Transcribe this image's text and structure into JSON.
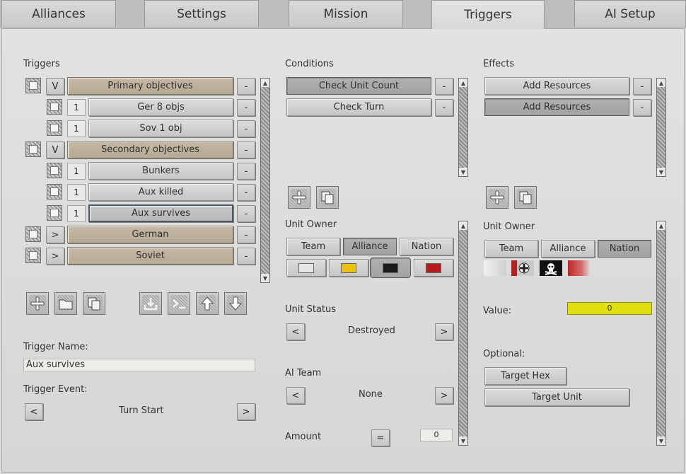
{
  "tabs": [
    "Alliances",
    "Settings",
    "Mission",
    "Triggers",
    "AI Setup"
  ],
  "triggers_panel": {
    "heading": "Triggers",
    "rows": [
      {
        "toggle": "V",
        "label": "Primary objectives",
        "remove": "-"
      },
      {
        "num": "1",
        "label": "Ger 8 objs",
        "remove": "-"
      },
      {
        "num": "1",
        "label": "Sov 1 obj",
        "remove": "-"
      },
      {
        "toggle": "V",
        "label": "Secondary objectives",
        "remove": "-"
      },
      {
        "num": "1",
        "label": "Bunkers",
        "remove": "-"
      },
      {
        "num": "1",
        "label": "Aux killed",
        "remove": "-"
      },
      {
        "num": "1",
        "label": "Aux survives",
        "remove": "-"
      },
      {
        "toggle": ">",
        "label": "German",
        "remove": "-"
      },
      {
        "toggle": ">",
        "label": "Soviet",
        "remove": "-"
      }
    ],
    "trigger_name_label": "Trigger Name:",
    "trigger_name_value": "Aux survives",
    "trigger_event_label": "Trigger Event:",
    "trigger_event_value": "Turn Start",
    "prev": "<",
    "next": ">"
  },
  "conditions_panel": {
    "heading": "Conditions",
    "items": [
      {
        "label": "Check Unit Count",
        "remove": "-"
      },
      {
        "label": "Check Turn",
        "remove": "-"
      }
    ],
    "unit_owner_label": "Unit Owner",
    "owner_tabs": [
      "Team",
      "Alliance",
      "Nation"
    ],
    "unit_status_label": "Unit Status",
    "unit_status_value": "Destroyed",
    "ai_team_label": "AI Team",
    "ai_team_value": "None",
    "amount_label": "Amount",
    "amount_operator": "=",
    "amount_value": "0",
    "prev": "<",
    "next": ">"
  },
  "effects_panel": {
    "heading": "Effects",
    "items": [
      {
        "label": "Add Resources",
        "remove": "-"
      },
      {
        "label": "Add Resources",
        "remove": "-"
      }
    ],
    "unit_owner_label": "Unit Owner",
    "owner_tabs": [
      "Team",
      "Alliance",
      "Nation"
    ],
    "value_label": "Value:",
    "value": "0",
    "optional_label": "Optional:",
    "target_hex": "Target Hex",
    "target_unit": "Target Unit"
  },
  "colors": {
    "swatch_white": "#e6e6e6",
    "swatch_yellow": "#e8c20e",
    "swatch_black": "#1c1c1c",
    "swatch_red": "#b51d1d",
    "value_field": "#e0e00f"
  }
}
